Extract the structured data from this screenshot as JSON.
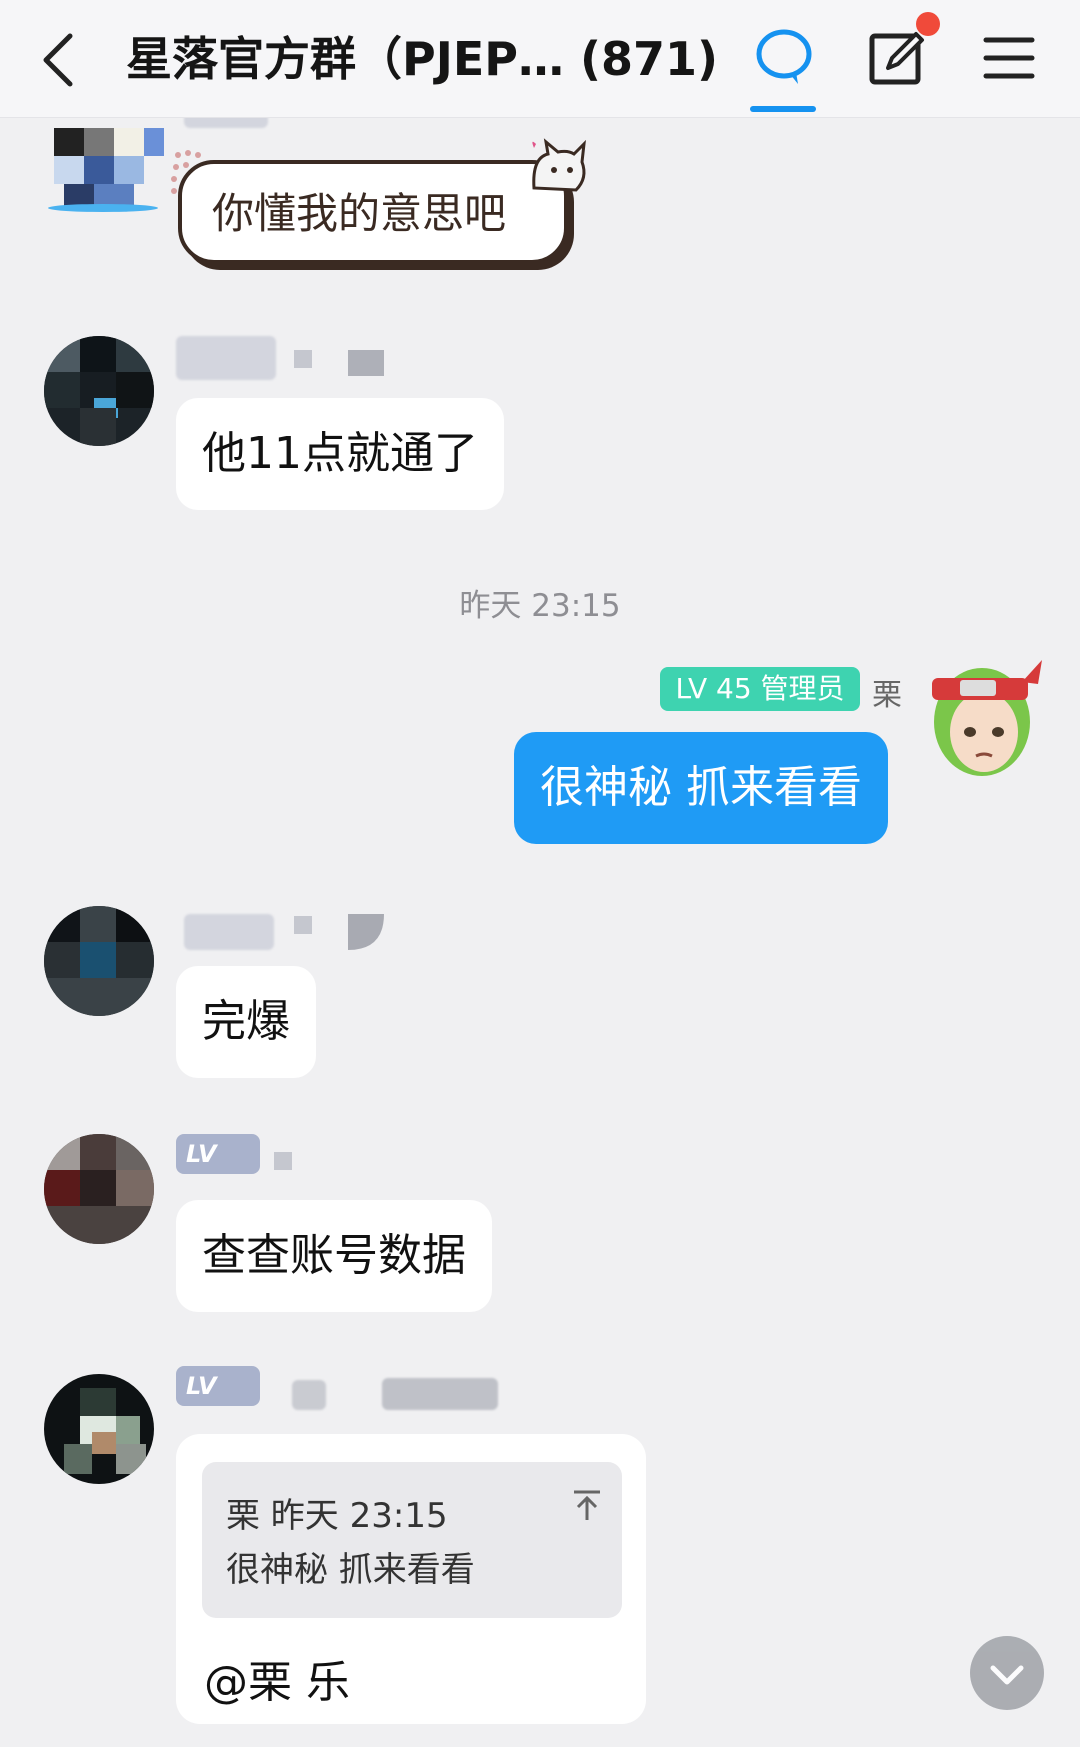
{
  "header": {
    "title": "星落官方群（PJEP… (871)",
    "back_icon": "chevron-left-icon",
    "chat_icon": "chat-bubble-icon",
    "edit_icon": "edit-square-icon",
    "menu_icon": "hamburger-menu-icon",
    "accent": "#1592f0",
    "notification_dot_color": "#f04a3a"
  },
  "messages": {
    "sticker_text": "你懂我的意思吧",
    "msg_2": "他11点就通了",
    "timestamp": "昨天 23:15",
    "self_badge": "LV 45 管理员",
    "self_name": "栗",
    "msg_self": "很神秘 抓来看看",
    "msg_4": "完爆",
    "msg_5_lv": "LV",
    "msg_5": "查查账号数据",
    "msg_6_lv": "LV",
    "quote_header": "栗  昨天  23:15",
    "quote_text": "很神秘 抓来看看",
    "mention": "@栗 乐"
  },
  "colors": {
    "self_bubble": "#1f9bf5",
    "admin_badge": "#3ed3b0",
    "background": "#f0f0f2"
  }
}
